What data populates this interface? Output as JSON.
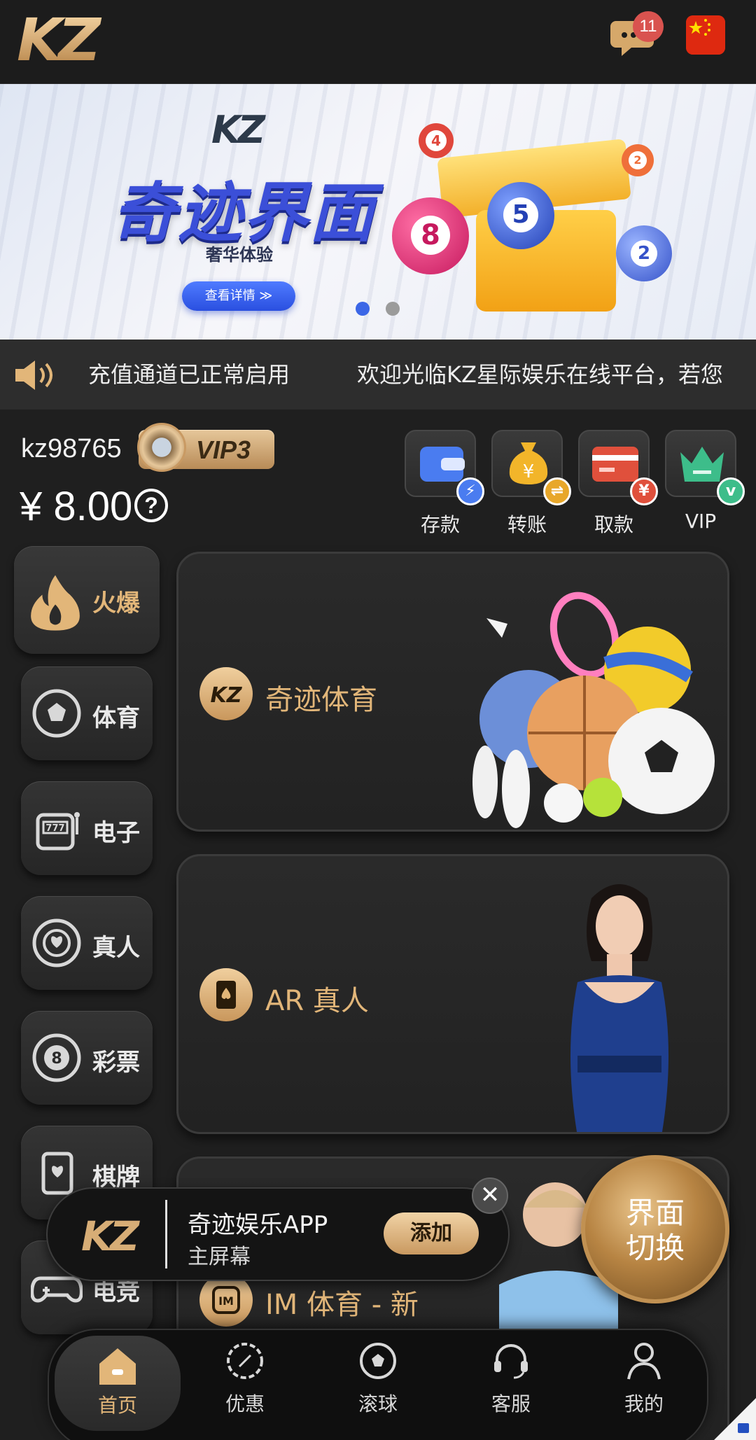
{
  "header": {
    "logo_text": "KZ",
    "message_count": "11",
    "language": "zh-CN"
  },
  "banner": {
    "logo_text": "KZ",
    "title": "奇迹界面",
    "subtitle": "奢华体验",
    "cta_label": "查看详情 ≫",
    "ball_numbers": [
      "4",
      "8",
      "5",
      "2",
      "2"
    ],
    "slides_total": 2,
    "active_slide": 1
  },
  "marquee": {
    "text": "充值通道已正常启用　　　欢迎光临KZ星际娱乐在线平台，若您"
  },
  "user": {
    "username": "kz98765",
    "vip_level": "VIP3",
    "balance": "¥ 8.00",
    "help_glyph": "?"
  },
  "quick_actions": [
    {
      "label": "存款",
      "sub_glyph": "⚡",
      "sub_color": "#4a7cf0"
    },
    {
      "label": "转账",
      "sub_glyph": "⇌",
      "sub_color": "#e8a72a"
    },
    {
      "label": "取款",
      "sub_glyph": "¥",
      "sub_color": "#e0503c"
    },
    {
      "label": "VIP",
      "sub_glyph": "v",
      "sub_color": "#3dbd8a"
    }
  ],
  "side_nav": [
    {
      "label": "火爆",
      "icon": "fire-icon"
    },
    {
      "label": "体育",
      "icon": "soccer-ball-icon"
    },
    {
      "label": "电子",
      "icon": "slot-machine-icon"
    },
    {
      "label": "真人",
      "icon": "casino-chip-icon"
    },
    {
      "label": "彩票",
      "icon": "lottery-ball-icon"
    },
    {
      "label": "棋牌",
      "icon": "playing-card-icon"
    },
    {
      "label": "电竞",
      "icon": "gamepad-icon"
    }
  ],
  "games": [
    {
      "title": "奇迹体育",
      "icon": "kz-logo-icon"
    },
    {
      "title": "AR 真人",
      "icon": "card-spade-icon"
    },
    {
      "title": "IM 体育 - 新",
      "icon": "im-logo-icon"
    }
  ],
  "install_prompt": {
    "logo_text": "KZ",
    "title": "奇迹娱乐APP",
    "subtitle": "主屏幕",
    "add_label": "添加",
    "close_glyph": "✕"
  },
  "switch_button": {
    "line1": "界面",
    "line2": "切换"
  },
  "tab_bar": [
    {
      "label": "首页"
    },
    {
      "label": "优惠"
    },
    {
      "label": "滚球"
    },
    {
      "label": "客服"
    },
    {
      "label": "我的"
    }
  ],
  "colors": {
    "gold": "#e2b679",
    "background": "#1f1f1f",
    "badge_red": "#d9534f",
    "banner_blue": "#3b4fd8"
  }
}
